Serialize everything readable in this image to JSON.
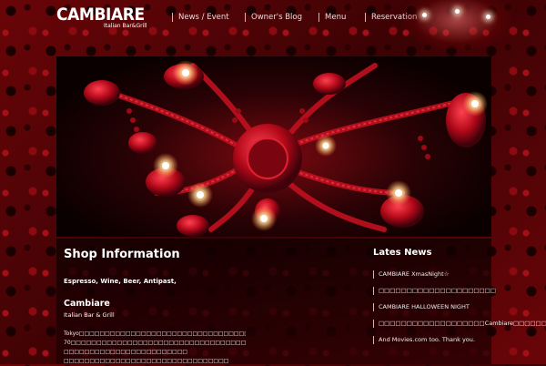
{
  "brand": {
    "name": "CAMBIARE",
    "subtitle": "Italian Bar&Grill"
  },
  "nav": [
    {
      "label": "News / Event"
    },
    {
      "label": "Owner's Blog"
    },
    {
      "label": "Menu"
    },
    {
      "label": "Reservation"
    }
  ],
  "shop": {
    "title": "Shop Information",
    "tagline": "Espresso, Wine, Beer, Antipast,",
    "name": "Cambiare",
    "subtitle": "Italian Bar & Grill",
    "description": [
      "Tokyo□□□□□□□□□□□□□□□□□□□□□□□□□□□□□□□□□□□□□□□□□□□",
      "70□□□□□□□□□□□□□□□□□□□□□□□□□□□□□□□□□□□□□□",
      "□□□□□□□□□□□□□□□□□□□□□□□□",
      "□□□□□□□□□□□□□□□□□□□□□□□□□□□□□□□□"
    ]
  },
  "news": {
    "title": "Lates News",
    "items": [
      {
        "label": "CAMBIARE XmasNight☆"
      },
      {
        "label": "□□□□□□□□□□□□□□□□□□□□□"
      },
      {
        "label": "CAMBIARE HALLOWEEN NIGHT"
      },
      {
        "label": "□□□□□□□□□□□□□□□□□□□Cambiare□□□□□□"
      },
      {
        "label": "And Movies.com too. Thank you."
      }
    ]
  },
  "colors": {
    "accent": "#c4101c",
    "background": "#5a0508",
    "hero_dark": "#0a0000"
  },
  "icons": {
    "hero": "chandelier-photo",
    "corner": "chandelier-photo"
  }
}
